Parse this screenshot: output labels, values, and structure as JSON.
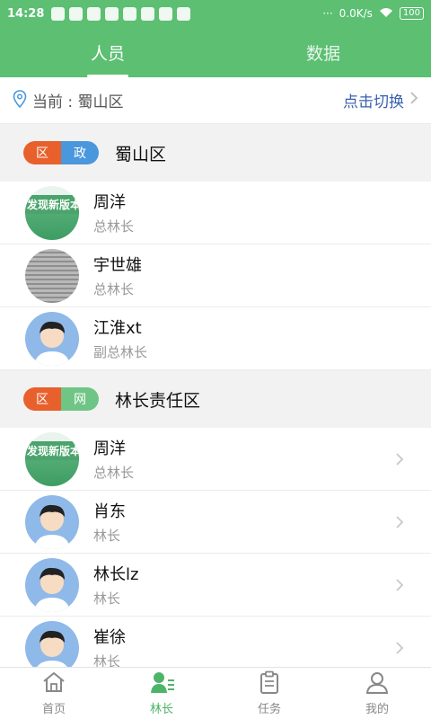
{
  "status_bar": {
    "time": "14:28",
    "speed": "0.0K/s",
    "battery": "100"
  },
  "tabs": [
    {
      "label": "人员",
      "active": true
    },
    {
      "label": "数据",
      "active": false
    }
  ],
  "location": {
    "current_text": "当前 : 蜀山区",
    "switch_label": "点击切换"
  },
  "sections": [
    {
      "badge_left": "区",
      "badge_right": "政",
      "badge_right_color": "#4a97dd",
      "title": "蜀山区",
      "people": [
        {
          "name": "周洋",
          "role": "总林长",
          "avatar": "green-banner",
          "avatar_text": "发现新版本"
        },
        {
          "name": "宇世雄",
          "role": "总林长",
          "avatar": "photo"
        },
        {
          "name": "江淮xt",
          "role": "副总林长",
          "avatar": "boy"
        }
      ]
    },
    {
      "badge_left": "区",
      "badge_right": "网",
      "badge_right_color": "#6fc585",
      "title": "林长责任区",
      "people": [
        {
          "name": "周洋",
          "role": "总林长",
          "avatar": "green-banner",
          "avatar_text": "发现新版本"
        },
        {
          "name": "肖东",
          "role": "林长",
          "avatar": "boy"
        },
        {
          "name": "林长lz",
          "role": "林长",
          "avatar": "boy"
        },
        {
          "name": "崔徐",
          "role": "林长",
          "avatar": "boy"
        }
      ]
    }
  ],
  "bottom_nav": [
    {
      "label": "首页",
      "icon": "home-icon",
      "active": false
    },
    {
      "label": "林长",
      "icon": "forest-ranger-icon",
      "active": true
    },
    {
      "label": "任务",
      "icon": "clipboard-icon",
      "active": false
    },
    {
      "label": "我的",
      "icon": "user-icon",
      "active": false
    }
  ],
  "colors": {
    "brand_green": "#5cbf72",
    "link_blue": "#3a5fae",
    "badge_orange": "#e8602c"
  }
}
